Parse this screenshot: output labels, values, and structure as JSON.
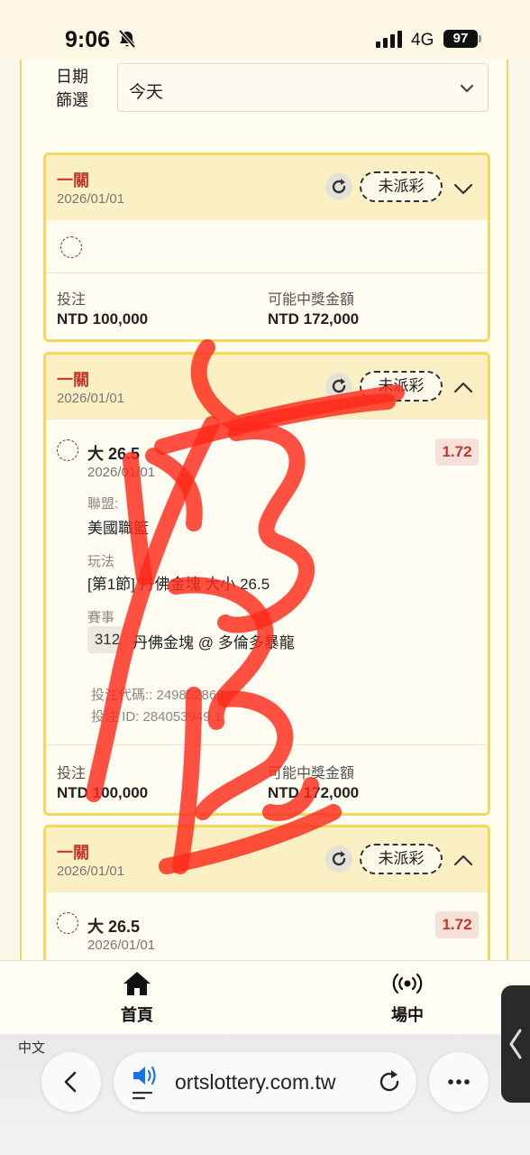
{
  "status_bar": {
    "time": "9:06",
    "network": "4G",
    "battery": "97"
  },
  "filter": {
    "label_line1": "日期",
    "label_line2": "篩選",
    "selected": "今天"
  },
  "cards": [
    {
      "title": "一關",
      "date": "2026/01/01",
      "status": "未派彩",
      "expanded": false,
      "stake_label": "投注",
      "stake": "NTD 100,000",
      "payout_label": "可能中獎金額",
      "payout": "NTD 172,000"
    },
    {
      "title": "一關",
      "date": "2026/01/01",
      "status": "未派彩",
      "expanded": true,
      "selection": {
        "title": "大 26.5",
        "date": "2026/01/01",
        "odds": "1.72",
        "league_label": "聯盟:",
        "league": "美國職籃",
        "market_label": "玩法",
        "market": "[第1節] 丹佛金塊 大小 26.5",
        "event_label": "賽事",
        "event_id": "312",
        "event": "丹佛金塊 @ 多倫多暴龍",
        "bet_code": "投注代碼:: 249852866",
        "bet_id": "投注 ID: 284053949.1"
      },
      "stake_label": "投注",
      "stake": "NTD 100,000",
      "payout_label": "可能中獎金額",
      "payout": "NTD 172,000"
    },
    {
      "title": "一關",
      "date": "2026/01/01",
      "status": "未派彩",
      "expanded": true,
      "selection": {
        "title": "大 26.5",
        "date": "2026/01/01",
        "odds": "1.72"
      }
    }
  ],
  "bottom_nav": {
    "home": "首頁",
    "live": "場中"
  },
  "language": "中文",
  "browser": {
    "url": "ortslottery.com.tw"
  },
  "colors": {
    "accent_red": "#c0392b",
    "card_border": "#f3d95a",
    "card_header": "#fbf0c4",
    "scribble": "#ff2a1a"
  }
}
